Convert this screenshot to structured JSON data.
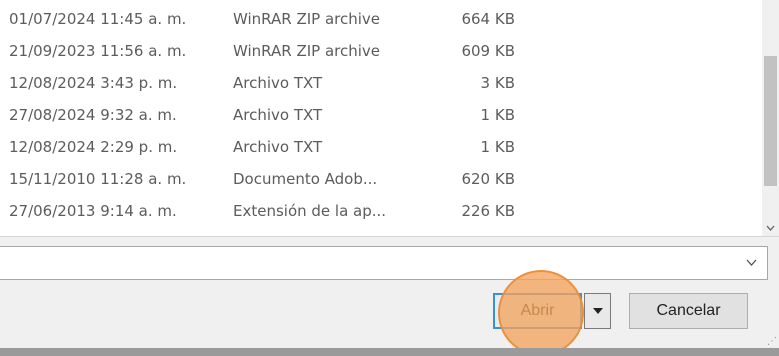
{
  "file_list": {
    "rows": [
      {
        "date": "01/07/2024 11:45 a. m.",
        "type": "WinRAR ZIP archive",
        "size": "664 KB"
      },
      {
        "date": "21/09/2023 11:56 a. m.",
        "type": "WinRAR ZIP archive",
        "size": "609 KB"
      },
      {
        "date": "12/08/2024 3:43 p. m.",
        "type": "Archivo TXT",
        "size": "3 KB"
      },
      {
        "date": "27/08/2024 9:32 a. m.",
        "type": "Archivo TXT",
        "size": "1 KB"
      },
      {
        "date": "12/08/2024 2:29 p. m.",
        "type": "Archivo TXT",
        "size": "1 KB"
      },
      {
        "date": "15/11/2010 11:28 a. m.",
        "type": "Documento Adob...",
        "size": "620 KB"
      },
      {
        "date": "27/06/2013 9:14 a. m.",
        "type": "Extensión de la ap...",
        "size": "226 KB"
      }
    ]
  },
  "filter_combo": {
    "value": "",
    "icon": "chevron-down-icon"
  },
  "buttons": {
    "open_label": "Abrir",
    "split_icon": "triangle-down-icon",
    "cancel_label": "Cancelar"
  },
  "colors": {
    "accent": "#3b8fd6",
    "click_highlight": "#f4a45c"
  }
}
